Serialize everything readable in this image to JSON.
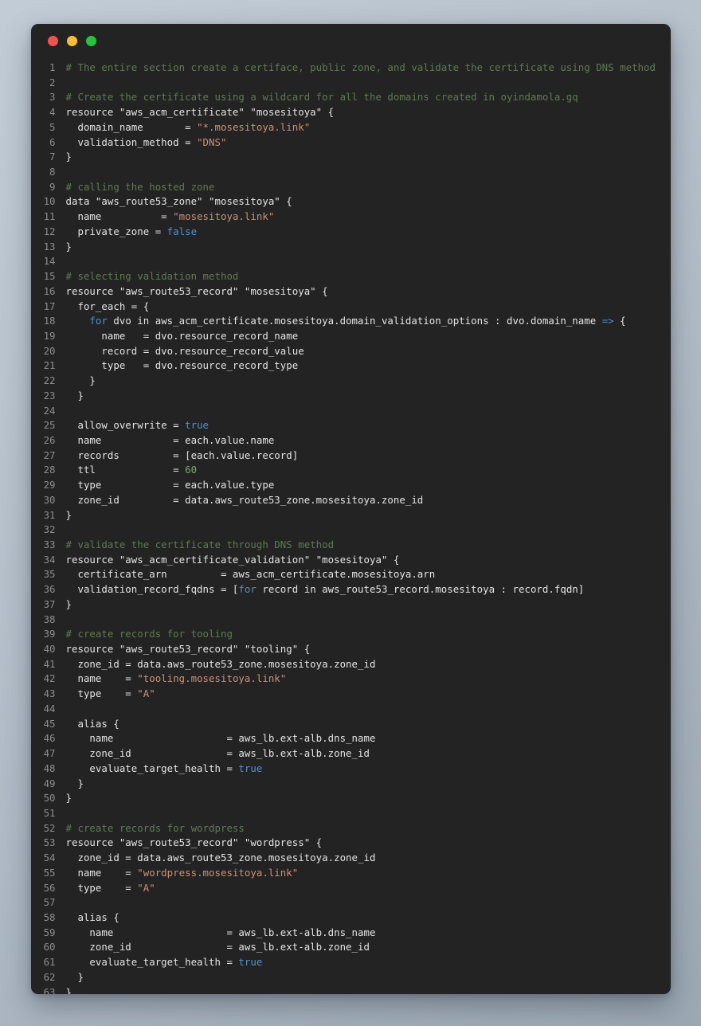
{
  "window": {
    "title": "",
    "traffic_lights": [
      {
        "name": "close",
        "color": "#f2534f"
      },
      {
        "name": "minimize",
        "color": "#fdbc2e"
      },
      {
        "name": "maximize",
        "color": "#24c43b"
      }
    ],
    "background": "#232323",
    "page_background": "#b3bec9"
  },
  "editor": {
    "language": "terraform",
    "first_line": 1,
    "last_line": 63,
    "total_lines": 63,
    "gutter_color": "#8d8d8d",
    "text_color": "#e4e4e4",
    "theme_colors": {
      "comment": "#5f7a50",
      "string": "#cd9076",
      "keyword": "#4d93d6",
      "number": "#7aa86a",
      "plain": "#e4e4e4"
    }
  },
  "lines": [
    {
      "n": "1",
      "tokens": [
        {
          "t": "cmt",
          "s": "# The entire section create a certiface, public zone, and validate the certificate using DNS method"
        }
      ]
    },
    {
      "n": "2",
      "tokens": []
    },
    {
      "n": "3",
      "tokens": [
        {
          "t": "cmt",
          "s": "# Create the certificate using a wildcard for all the domains created in oyindamola.gq"
        }
      ]
    },
    {
      "n": "4",
      "tokens": [
        {
          "t": "pln",
          "s": "resource \"aws_acm_certificate\" \"mosesitoya\" {"
        }
      ]
    },
    {
      "n": "5",
      "tokens": [
        {
          "t": "pln",
          "s": "  domain_name       = "
        },
        {
          "t": "str",
          "s": "\"*.mosesitoya.link\""
        }
      ]
    },
    {
      "n": "6",
      "tokens": [
        {
          "t": "pln",
          "s": "  validation_method = "
        },
        {
          "t": "str",
          "s": "\"DNS\""
        }
      ]
    },
    {
      "n": "7",
      "tokens": [
        {
          "t": "pln",
          "s": "}"
        }
      ]
    },
    {
      "n": "8",
      "tokens": []
    },
    {
      "n": "9",
      "tokens": [
        {
          "t": "cmt",
          "s": "# calling the hosted zone"
        }
      ]
    },
    {
      "n": "10",
      "tokens": [
        {
          "t": "pln",
          "s": "data \"aws_route53_zone\" \"mosesitoya\" {"
        }
      ]
    },
    {
      "n": "11",
      "tokens": [
        {
          "t": "pln",
          "s": "  name          = "
        },
        {
          "t": "str",
          "s": "\"mosesitoya.link\""
        }
      ]
    },
    {
      "n": "12",
      "tokens": [
        {
          "t": "pln",
          "s": "  private_zone = "
        },
        {
          "t": "kw",
          "s": "false"
        }
      ]
    },
    {
      "n": "13",
      "tokens": [
        {
          "t": "pln",
          "s": "}"
        }
      ]
    },
    {
      "n": "14",
      "tokens": []
    },
    {
      "n": "15",
      "tokens": [
        {
          "t": "cmt",
          "s": "# selecting validation method"
        }
      ]
    },
    {
      "n": "16",
      "tokens": [
        {
          "t": "pln",
          "s": "resource \"aws_route53_record\" \"mosesitoya\" {"
        }
      ]
    },
    {
      "n": "17",
      "tokens": [
        {
          "t": "pln",
          "s": "  for_each = {"
        }
      ]
    },
    {
      "n": "18",
      "tokens": [
        {
          "t": "pln",
          "s": "    "
        },
        {
          "t": "kw",
          "s": "for"
        },
        {
          "t": "pln",
          "s": " dvo in aws_acm_certificate.mosesitoya.domain_validation_options : dvo.domain_name "
        },
        {
          "t": "kw",
          "s": "=>"
        },
        {
          "t": "pln",
          "s": " {"
        }
      ]
    },
    {
      "n": "19",
      "tokens": [
        {
          "t": "pln",
          "s": "      name   = dvo.resource_record_name"
        }
      ]
    },
    {
      "n": "20",
      "tokens": [
        {
          "t": "pln",
          "s": "      record = dvo.resource_record_value"
        }
      ]
    },
    {
      "n": "21",
      "tokens": [
        {
          "t": "pln",
          "s": "      type   = dvo.resource_record_type"
        }
      ]
    },
    {
      "n": "22",
      "tokens": [
        {
          "t": "pln",
          "s": "    }"
        }
      ]
    },
    {
      "n": "23",
      "tokens": [
        {
          "t": "pln",
          "s": "  }"
        }
      ]
    },
    {
      "n": "24",
      "tokens": []
    },
    {
      "n": "25",
      "tokens": [
        {
          "t": "pln",
          "s": "  allow_overwrite = "
        },
        {
          "t": "kw",
          "s": "true"
        }
      ]
    },
    {
      "n": "26",
      "tokens": [
        {
          "t": "pln",
          "s": "  name            = each.value.name"
        }
      ]
    },
    {
      "n": "27",
      "tokens": [
        {
          "t": "pln",
          "s": "  records         = [each.value.record]"
        }
      ]
    },
    {
      "n": "28",
      "tokens": [
        {
          "t": "pln",
          "s": "  ttl             = "
        },
        {
          "t": "num",
          "s": "60"
        }
      ]
    },
    {
      "n": "29",
      "tokens": [
        {
          "t": "pln",
          "s": "  type            = each.value.type"
        }
      ]
    },
    {
      "n": "30",
      "tokens": [
        {
          "t": "pln",
          "s": "  zone_id         = data.aws_route53_zone.mosesitoya.zone_id"
        }
      ]
    },
    {
      "n": "31",
      "tokens": [
        {
          "t": "pln",
          "s": "}"
        }
      ]
    },
    {
      "n": "32",
      "tokens": []
    },
    {
      "n": "33",
      "tokens": [
        {
          "t": "cmt",
          "s": "# validate the certificate through DNS method"
        }
      ]
    },
    {
      "n": "34",
      "tokens": [
        {
          "t": "pln",
          "s": "resource \"aws_acm_certificate_validation\" \"mosesitoya\" {"
        }
      ]
    },
    {
      "n": "35",
      "tokens": [
        {
          "t": "pln",
          "s": "  certificate_arn         = aws_acm_certificate.mosesitoya.arn"
        }
      ]
    },
    {
      "n": "36",
      "tokens": [
        {
          "t": "pln",
          "s": "  validation_record_fqdns = ["
        },
        {
          "t": "kw",
          "s": "for"
        },
        {
          "t": "pln",
          "s": " record in aws_route53_record.mosesitoya : record.fqdn]"
        }
      ]
    },
    {
      "n": "37",
      "tokens": [
        {
          "t": "pln",
          "s": "}"
        }
      ]
    },
    {
      "n": "38",
      "tokens": []
    },
    {
      "n": "39",
      "tokens": [
        {
          "t": "cmt",
          "s": "# create records for tooling"
        }
      ]
    },
    {
      "n": "40",
      "tokens": [
        {
          "t": "pln",
          "s": "resource \"aws_route53_record\" \"tooling\" {"
        }
      ]
    },
    {
      "n": "41",
      "tokens": [
        {
          "t": "pln",
          "s": "  zone_id = data.aws_route53_zone.mosesitoya.zone_id"
        }
      ]
    },
    {
      "n": "42",
      "tokens": [
        {
          "t": "pln",
          "s": "  name    = "
        },
        {
          "t": "str",
          "s": "\"tooling.mosesitoya.link\""
        }
      ]
    },
    {
      "n": "43",
      "tokens": [
        {
          "t": "pln",
          "s": "  type    = "
        },
        {
          "t": "str",
          "s": "\"A\""
        }
      ]
    },
    {
      "n": "44",
      "tokens": []
    },
    {
      "n": "45",
      "tokens": [
        {
          "t": "pln",
          "s": "  alias {"
        }
      ]
    },
    {
      "n": "46",
      "tokens": [
        {
          "t": "pln",
          "s": "    name                   = aws_lb.ext-alb.dns_name"
        }
      ]
    },
    {
      "n": "47",
      "tokens": [
        {
          "t": "pln",
          "s": "    zone_id                = aws_lb.ext-alb.zone_id"
        }
      ]
    },
    {
      "n": "48",
      "tokens": [
        {
          "t": "pln",
          "s": "    evaluate_target_health = "
        },
        {
          "t": "kw",
          "s": "true"
        }
      ]
    },
    {
      "n": "49",
      "tokens": [
        {
          "t": "pln",
          "s": "  }"
        }
      ]
    },
    {
      "n": "50",
      "tokens": [
        {
          "t": "pln",
          "s": "}"
        }
      ]
    },
    {
      "n": "51",
      "tokens": []
    },
    {
      "n": "52",
      "tokens": [
        {
          "t": "cmt",
          "s": "# create records for wordpress"
        }
      ]
    },
    {
      "n": "53",
      "tokens": [
        {
          "t": "pln",
          "s": "resource \"aws_route53_record\" \"wordpress\" {"
        }
      ]
    },
    {
      "n": "54",
      "tokens": [
        {
          "t": "pln",
          "s": "  zone_id = data.aws_route53_zone.mosesitoya.zone_id"
        }
      ]
    },
    {
      "n": "55",
      "tokens": [
        {
          "t": "pln",
          "s": "  name    = "
        },
        {
          "t": "str",
          "s": "\"wordpress.mosesitoya.link\""
        }
      ]
    },
    {
      "n": "56",
      "tokens": [
        {
          "t": "pln",
          "s": "  type    = "
        },
        {
          "t": "str",
          "s": "\"A\""
        }
      ]
    },
    {
      "n": "57",
      "tokens": []
    },
    {
      "n": "58",
      "tokens": [
        {
          "t": "pln",
          "s": "  alias {"
        }
      ]
    },
    {
      "n": "59",
      "tokens": [
        {
          "t": "pln",
          "s": "    name                   = aws_lb.ext-alb.dns_name"
        }
      ]
    },
    {
      "n": "60",
      "tokens": [
        {
          "t": "pln",
          "s": "    zone_id                = aws_lb.ext-alb.zone_id"
        }
      ]
    },
    {
      "n": "61",
      "tokens": [
        {
          "t": "pln",
          "s": "    evaluate_target_health = "
        },
        {
          "t": "kw",
          "s": "true"
        }
      ]
    },
    {
      "n": "62",
      "tokens": [
        {
          "t": "pln",
          "s": "  }"
        }
      ]
    },
    {
      "n": "63",
      "tokens": [
        {
          "t": "pln",
          "s": "}"
        }
      ]
    }
  ]
}
